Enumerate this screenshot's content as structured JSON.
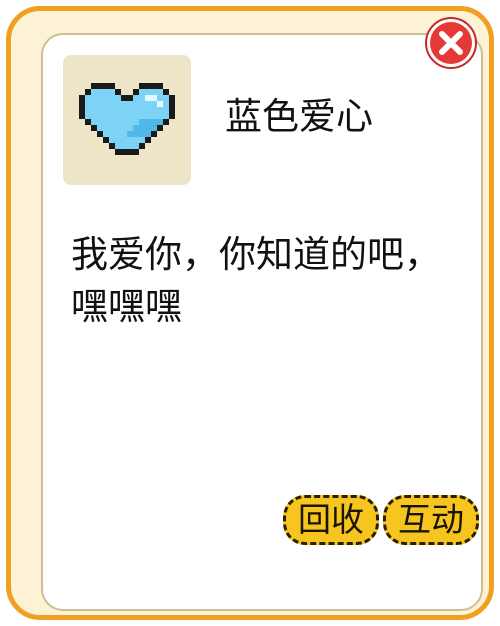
{
  "item": {
    "name": "蓝色爱心",
    "description": "我爱你，你知道的吧，嘿嘿嘿",
    "icon": "pixel-blue-heart-icon"
  },
  "buttons": {
    "recycle_label": "回收",
    "interact_label": "互动",
    "close_icon": "close-icon"
  },
  "colors": {
    "frame": "#f0a020",
    "frame_fill": "#fdf1d6",
    "card_border": "#cdbf94",
    "icon_bg": "#ece5c8",
    "heart": "#7dd3f5",
    "button": "#f7c520",
    "close": "#e53935"
  }
}
